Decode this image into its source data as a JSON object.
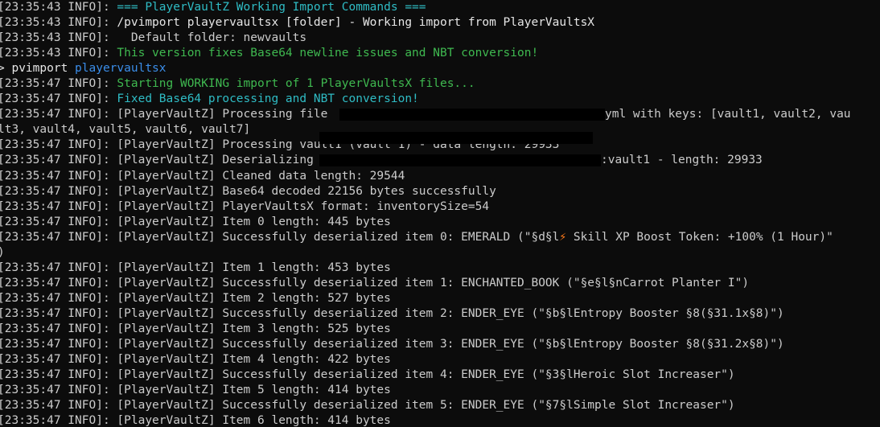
{
  "terminal": {
    "lines": [
      {
        "prefix": "[23:35:43 INFO]: ",
        "text": "=== PlayerVaultZ Working Import Commands ===",
        "color": "teal"
      },
      {
        "prefix": "[23:35:43 INFO]: ",
        "text": "/pvimport playervaultsx [folder] - Working import from PlayerVaultsX",
        "color": "bright"
      },
      {
        "prefix": "[23:35:43 INFO]: ",
        "text": "  Default folder: newvaults",
        "color": "white"
      },
      {
        "prefix": "[23:35:43 INFO]: ",
        "text": "This version fixes Base64 newline issues and NBT conversion!",
        "color": "green"
      },
      {
        "prefix": "> pvimport ",
        "text": "playervaultsx",
        "color": "blue",
        "prefix_color": "bright"
      },
      {
        "prefix": "[23:35:47 INFO]: ",
        "text": "Starting WORKING import of 1 PlayerVaultsX files...",
        "color": "green"
      },
      {
        "prefix": "[23:35:47 INFO]: ",
        "text": "Fixed Base64 processing and NBT conversion!",
        "color": "teal"
      },
      {
        "prefix": "[23:35:47 INFO]: ",
        "text": "[PlayerVaultZ] Processing file ",
        "suffix": "yml with keys: [vault1, vault2, vau",
        "color": "white",
        "redact": "r1"
      },
      {
        "prefix": "",
        "text": "lt3, vault4, vault5, vault6, vault7]",
        "color": "white"
      },
      {
        "prefix": "[23:35:47 INFO]: ",
        "text": "[PlayerVaultZ] Processing vault1 (vault 1) - data length: 29933",
        "color": "white",
        "redact": "r2"
      },
      {
        "prefix": "[23:35:47 INFO]: ",
        "text": "[PlayerVaultZ] Deserializing ",
        "suffix": ":vault1 - length: 29933",
        "color": "white",
        "redact": "r3"
      },
      {
        "prefix": "[23:35:47 INFO]: ",
        "text": "[PlayerVaultZ] Cleaned data length: 29544",
        "color": "white"
      },
      {
        "prefix": "[23:35:47 INFO]: ",
        "text": "[PlayerVaultZ] Base64 decoded 22156 bytes successfully",
        "color": "white"
      },
      {
        "prefix": "[23:35:47 INFO]: ",
        "text": "[PlayerVaultZ] PlayerVaultsX format: inventorySize=54",
        "color": "white"
      },
      {
        "prefix": "[23:35:47 INFO]: ",
        "text": "[PlayerVaultZ] Item 0 length: 445 bytes",
        "color": "white"
      },
      {
        "prefix": "[23:35:47 INFO]: ",
        "text": "[PlayerVaultZ] Successfully deserialized item 0: EMERALD (\"§d§l",
        "bolt": "⚡",
        "suffix": " Skill XP Boost Token: +100% (1 Hour)\"",
        "color": "white"
      },
      {
        "prefix": "",
        "text": ")",
        "color": "white"
      },
      {
        "prefix": "[23:35:47 INFO]: ",
        "text": "[PlayerVaultZ] Item 1 length: 453 bytes",
        "color": "white"
      },
      {
        "prefix": "[23:35:47 INFO]: ",
        "text": "[PlayerVaultZ] Successfully deserialized item 1: ENCHANTED_BOOK (\"§e§l§nCarrot Planter I\")",
        "color": "white"
      },
      {
        "prefix": "[23:35:47 INFO]: ",
        "text": "[PlayerVaultZ] Item 2 length: 527 bytes",
        "color": "white"
      },
      {
        "prefix": "[23:35:47 INFO]: ",
        "text": "[PlayerVaultZ] Successfully deserialized item 2: ENDER_EYE (\"§b§lEntropy Booster §8(§31.1x§8)\")",
        "color": "white"
      },
      {
        "prefix": "[23:35:47 INFO]: ",
        "text": "[PlayerVaultZ] Item 3 length: 525 bytes",
        "color": "white"
      },
      {
        "prefix": "[23:35:47 INFO]: ",
        "text": "[PlayerVaultZ] Successfully deserialized item 3: ENDER_EYE (\"§b§lEntropy Booster §8(§31.2x§8)\")",
        "color": "white"
      },
      {
        "prefix": "[23:35:47 INFO]: ",
        "text": "[PlayerVaultZ] Item 4 length: 422 bytes",
        "color": "white"
      },
      {
        "prefix": "[23:35:47 INFO]: ",
        "text": "[PlayerVaultZ] Successfully deserialized item 4: ENDER_EYE (\"§3§lHeroic Slot Increaser\")",
        "color": "white"
      },
      {
        "prefix": "[23:35:47 INFO]: ",
        "text": "[PlayerVaultZ] Item 5 length: 414 bytes",
        "color": "white"
      },
      {
        "prefix": "[23:35:47 INFO]: ",
        "text": "[PlayerVaultZ] Successfully deserialized item 5: ENDER_EYE (\"§7§lSimple Slot Increaser\")",
        "color": "white"
      },
      {
        "prefix": "[23:35:47 INFO]: ",
        "text": "[PlayerVaultZ] Item 6 length: 414 bytes",
        "color": "white"
      }
    ]
  },
  "colors": {
    "background": "#0c0c0c",
    "default_text": "#cccccc",
    "green": "#3fb950",
    "teal": "#2fbcc5",
    "blue": "#3b8eea",
    "bolt": "#ff7a1a"
  },
  "icons": {
    "bolt": "lightning-bolt-icon"
  }
}
